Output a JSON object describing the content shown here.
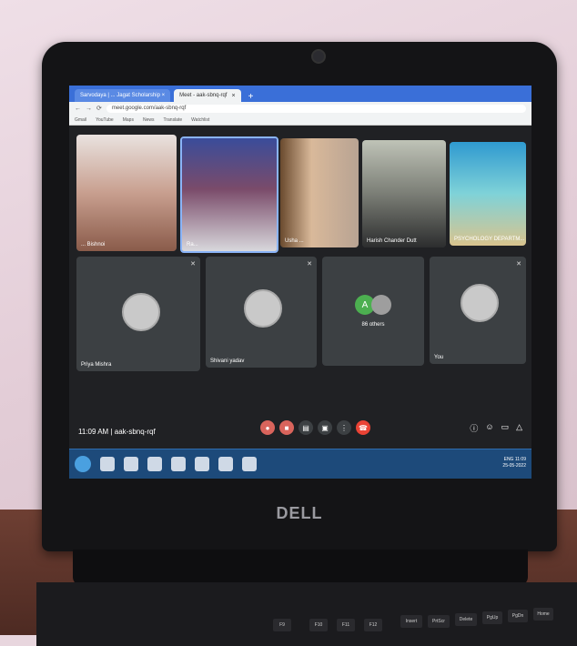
{
  "browser": {
    "tabs": [
      {
        "label": "Sarvodaya | ... Jagat Scholarship ×"
      },
      {
        "label": "Meet - aak-sbnq-rqf"
      }
    ],
    "url": "meet.google.com/aak-sbnq-rqf",
    "bookmarks": [
      "Gmail",
      "YouTube",
      "Maps",
      "News",
      "Translate",
      "Watchlist"
    ]
  },
  "meet": {
    "participants_top": [
      {
        "name": "... Bishnoi"
      },
      {
        "name": "Ra..."
      },
      {
        "name": "Usha ..."
      },
      {
        "name": "Harish Chander Dutt"
      },
      {
        "name": "PSYCHOLOGY DEPARTM..."
      }
    ],
    "participants_bottom": [
      {
        "name": "Priya Mishra"
      },
      {
        "name": "Shivani yadav"
      },
      {
        "name": "86 others",
        "initial": "A"
      },
      {
        "name": "You"
      }
    ],
    "time": "11:09 AM",
    "meeting_code": "aak-sbnq-rqf",
    "separator": "|"
  },
  "laptop": {
    "brand": "DELL"
  },
  "taskbar": {
    "clock": "11:09",
    "date": "25-05-2022",
    "lang": "ENG"
  },
  "keyboard": {
    "keys": [
      "F9",
      "F10",
      "F11",
      "F12",
      "Insert",
      "PrtScr",
      "Delete",
      "PgUp",
      "PgDn",
      "Home"
    ]
  },
  "colors": {
    "meet_bg": "#202124",
    "tile_bg": "#3c4043",
    "end_call": "#ea4335",
    "browser_bar": "#3a6fd8"
  }
}
